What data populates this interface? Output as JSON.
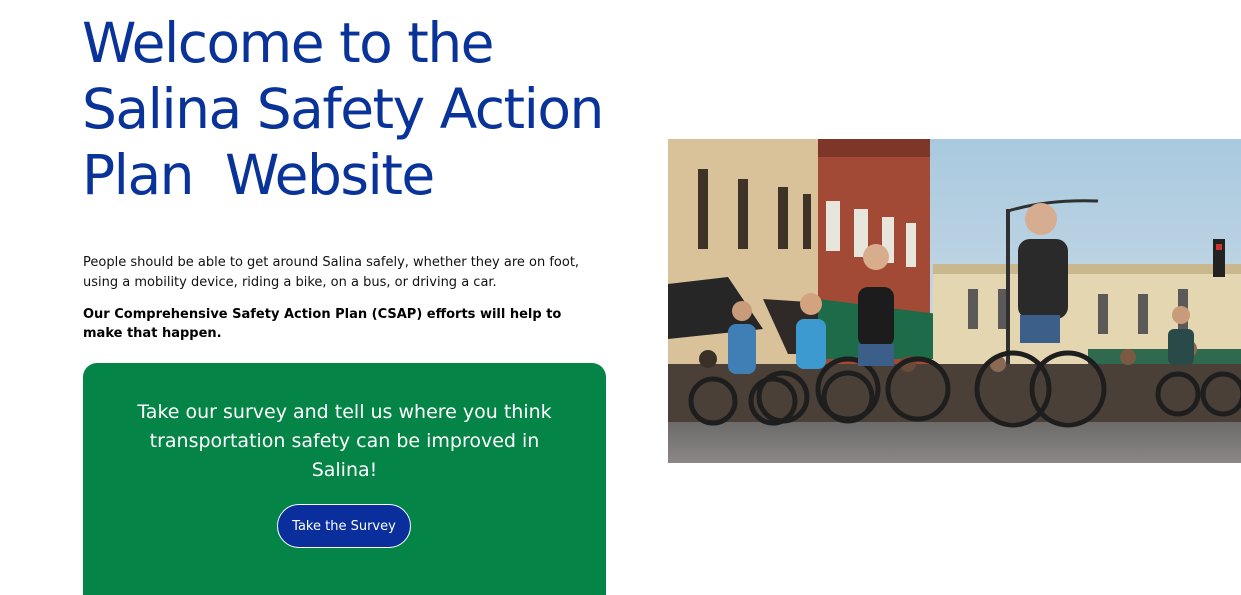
{
  "hero": {
    "title_lines": [
      "Welcome to the",
      "Salina Safety Action",
      "Plan  Website"
    ]
  },
  "intro": {
    "paragraph": "People should be able to get around Salina safely, whether they are on foot, using a mobility device, riding a bike, on a bus, or driving a car.",
    "bold_paragraph": "Our Comprehensive Safety Action Plan (CSAP) efforts will help to make that happen."
  },
  "survey": {
    "text": "Take our survey and tell us where you think transportation safety can be improved in Salina!",
    "button_label": "Take the Survey"
  },
  "colors": {
    "title": "#0a3399",
    "card_background": "#058448",
    "button_background": "#0a2f9c"
  }
}
